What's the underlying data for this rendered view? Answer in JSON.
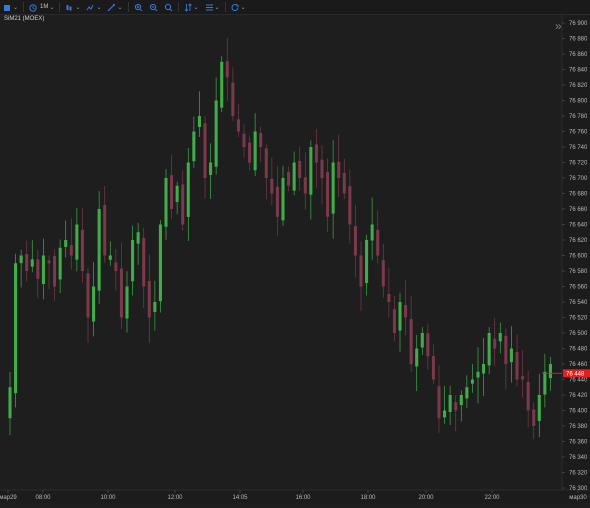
{
  "toolbar": {
    "interval_label": "1М",
    "items": [
      {
        "icon": "menu-icon"
      },
      {
        "icon": "clock-icon",
        "label": "1М"
      },
      {
        "icon": "candles-icon"
      },
      {
        "icon": "indicator-icon"
      },
      {
        "icon": "draw-icon"
      },
      {
        "icon": "zoom-in-icon"
      },
      {
        "icon": "zoom-out-icon"
      },
      {
        "icon": "search-icon"
      },
      {
        "icon": "sort-icon"
      },
      {
        "icon": "list-icon"
      },
      {
        "icon": "refresh-icon"
      }
    ]
  },
  "chart_title": "SiM21 (MOEX)",
  "colors": {
    "background": "#1e1e1e",
    "up": "#3fae49",
    "down": "#7a3a4a",
    "grid": "#2a2a2a",
    "price_marker": "#e02020"
  },
  "chart_data": {
    "type": "candlestick",
    "title": "SiM21 (MOEX)",
    "y_ticks": [
      "76 900",
      "76 880",
      "76 860",
      "76 840",
      "76 820",
      "76 800",
      "76 780",
      "76 760",
      "76 740",
      "76 720",
      "76 700",
      "76 680",
      "76 660",
      "76 640",
      "76 620",
      "76 600",
      "76 580",
      "76 560",
      "76 540",
      "76 520",
      "76 500",
      "76 480",
      "76 460",
      "76 440",
      "76 420",
      "76 400",
      "76 380",
      "76 360",
      "76 340",
      "76 320",
      "76 300"
    ],
    "y_values": [
      76900,
      76880,
      76860,
      76840,
      76820,
      76800,
      76780,
      76760,
      76740,
      76720,
      76700,
      76680,
      76660,
      76640,
      76620,
      76600,
      76580,
      76560,
      76540,
      76520,
      76500,
      76480,
      76460,
      76440,
      76420,
      76400,
      76380,
      76360,
      76340,
      76320,
      76300
    ],
    "ylim": [
      76300,
      76900
    ],
    "x_ticks": [
      "мар29",
      "08:00",
      "10:00",
      "12:00",
      "14:05",
      "16:00",
      "18:00",
      "20:00",
      "22:00",
      "мар30"
    ],
    "last_price": "76 448",
    "last_value": 76448,
    "closes": [
      76430,
      76590,
      76600,
      76580,
      76595,
      76570,
      76600,
      76590,
      76560,
      76610,
      76620,
      76600,
      76640,
      76580,
      76520,
      76560,
      76660,
      76600,
      76600,
      76580,
      76520,
      76560,
      76620,
      76630,
      76560,
      76520,
      76540,
      76640,
      76700,
      76660,
      76690,
      76640,
      76720,
      76760,
      76780,
      76700,
      76720,
      76800,
      76850,
      76830,
      76780,
      76760,
      76740,
      76720,
      76760,
      76740,
      76700,
      76680,
      76650,
      76700,
      76690,
      76720,
      76700,
      76680,
      76740,
      76720,
      76700,
      76650,
      76720,
      76700,
      76680,
      76640,
      76600,
      76560,
      76620,
      76640,
      76600,
      76560,
      76540,
      76500,
      76540,
      76520,
      76460,
      76480,
      76500,
      76470,
      76440,
      76390,
      76400,
      76420,
      76400,
      76420,
      76430,
      76440,
      76450,
      76460,
      76500,
      76480,
      76500,
      76460,
      76480,
      76440,
      76440,
      76400,
      76380,
      76420,
      76450,
      76460
    ]
  }
}
